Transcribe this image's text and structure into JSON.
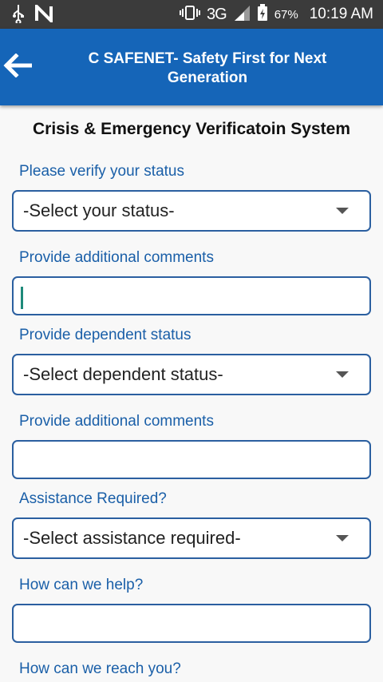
{
  "status_bar": {
    "network": "3G",
    "network_sup": "3G",
    "battery": "67%",
    "time": "10:19 AM"
  },
  "app_bar": {
    "title": "C SAFENET- Safety First for Next Generation"
  },
  "form": {
    "heading": "Crisis & Emergency Verificatoin System",
    "fields": [
      {
        "label": "Please verify your status",
        "type": "select",
        "value": "-Select your status-"
      },
      {
        "label": "Provide additional comments",
        "type": "text",
        "value": "",
        "focused": true
      },
      {
        "label": "Provide dependent status",
        "type": "select",
        "value": "-Select dependent status-"
      },
      {
        "label": "Provide additional comments",
        "type": "text",
        "value": ""
      },
      {
        "label": "Assistance Required?",
        "type": "select",
        "value": "-Select assistance required-"
      },
      {
        "label": "How can we help?",
        "type": "text",
        "value": ""
      },
      {
        "label": "How can we reach you?",
        "type": "text",
        "value": ""
      }
    ]
  }
}
